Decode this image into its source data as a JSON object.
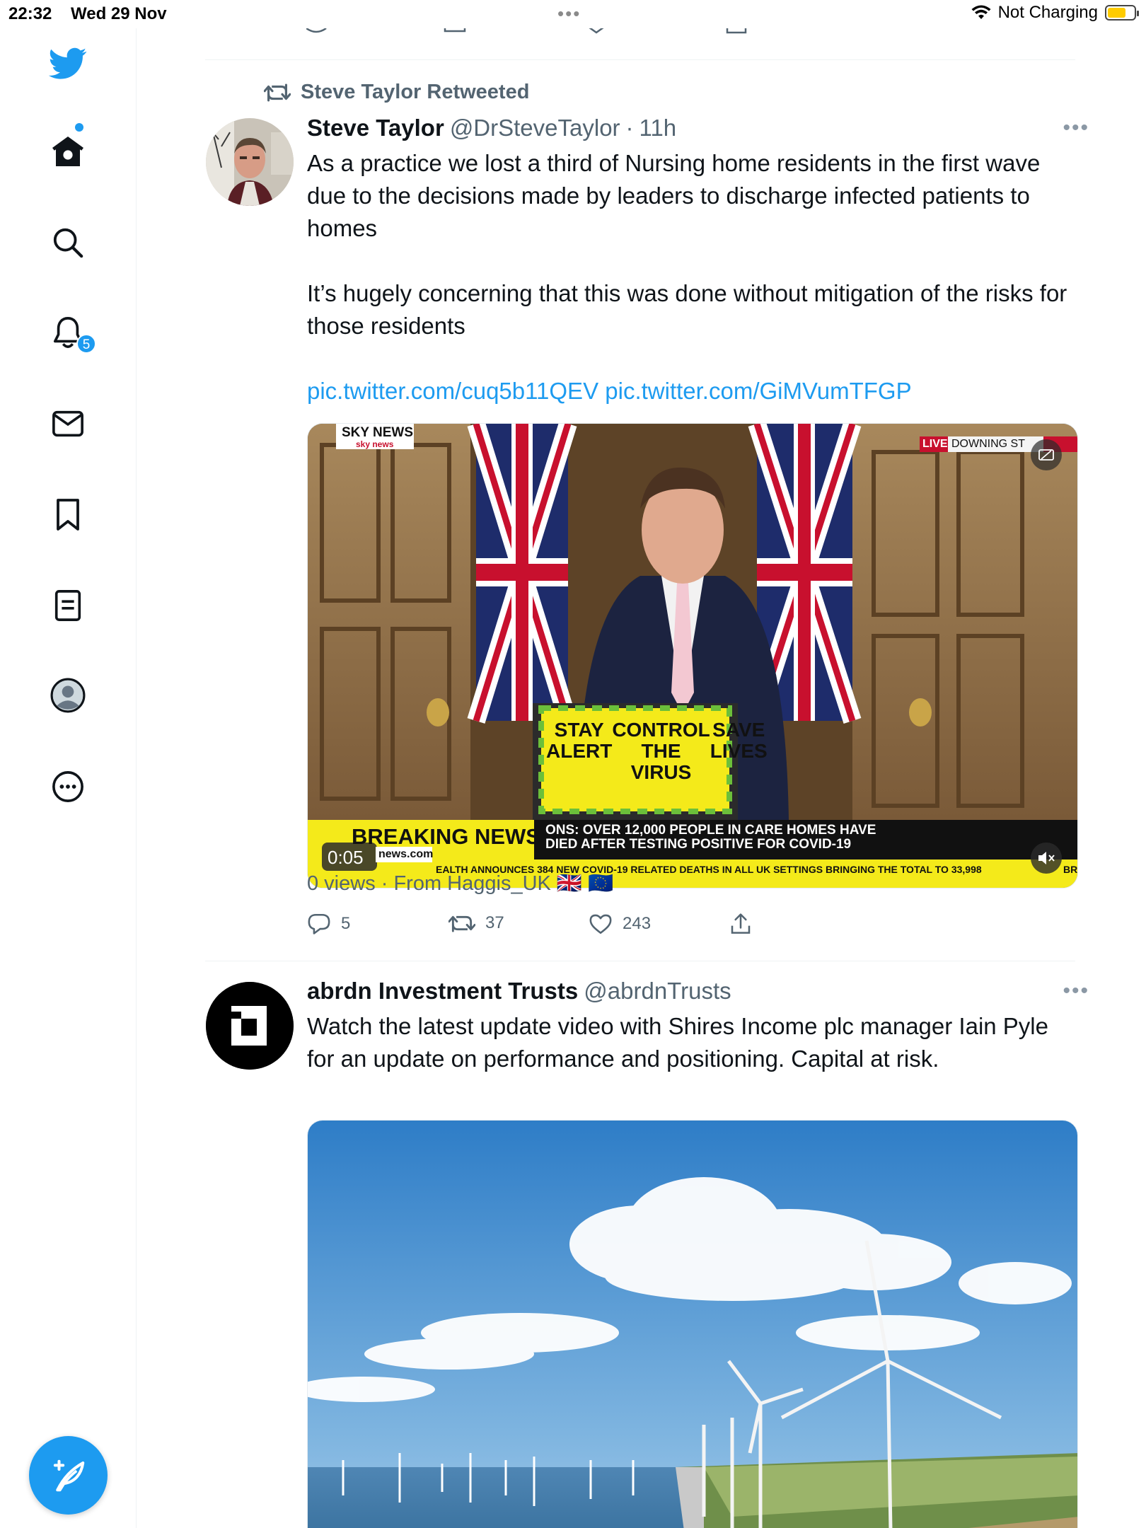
{
  "status_bar": {
    "time": "22:32",
    "date": "Wed 29 Nov",
    "charging": "Not Charging"
  },
  "sidebar": {
    "items": [
      {
        "icon": "twitter-bird-icon"
      },
      {
        "icon": "home-icon"
      },
      {
        "icon": "search-icon"
      },
      {
        "icon": "notifications-icon",
        "badge": "5"
      },
      {
        "icon": "messages-icon"
      },
      {
        "icon": "bookmarks-icon"
      },
      {
        "icon": "lists-icon"
      },
      {
        "icon": "profile-icon"
      },
      {
        "icon": "more-icon"
      }
    ],
    "compose_icon": "compose-tweet-icon"
  },
  "tweet1": {
    "retweeted_by": "Steve Taylor Retweeted",
    "name": "Steve Taylor",
    "handle": "@DrSteveTaylor",
    "time": "11h",
    "text_p1": "As a practice we lost a third of Nursing home residents in the first wave due to the decisions made by leaders to discharge infected patients to homes",
    "text_p2": "It’s hugely concerning that this was done without mitigation of the risks for those residents",
    "link1": "pic.twitter.com/cuq5b11QEV",
    "link2": "pic.twitter.com/GiMVumTFGP",
    "video": {
      "channel": "SKY NEWS",
      "channel_sub": "sky news",
      "live": "LIVE",
      "location": "DOWNING ST",
      "podium_1a": "STAY",
      "podium_1b": "ALERT",
      "podium_2a": "CONTROL",
      "podium_2b": "THE VIRUS",
      "podium_3a": "SAVE",
      "podium_3b": "LIVES",
      "breaking": "BREAKING NEWS",
      "headline_1": "ONS: OVER 12,000 PEOPLE IN CARE HOMES HAVE",
      "headline_2": "DIED AFTER TESTING POSITIVE FOR COVID-19",
      "site": "news.com",
      "ticker": "EALTH ANNOUNCES 384 NEW COVID-19 RELATED DEATHS IN ALL UK SETTINGS BRINGING THE TOTAL TO 33,998",
      "ticker_end": "BRE",
      "timestamp": "0:05"
    },
    "views": "0 views · From Haggis_UK 🇬🇧 🇪🇺",
    "replies": "5",
    "retweets": "37",
    "likes": "243"
  },
  "tweet2": {
    "name": "abrdn Investment Trusts",
    "handle": "@abrdnTrusts",
    "logo_letter": "a",
    "text": "Watch the latest update video with Shires Income plc manager Iain Pyle for an update on performance and positioning. Capital at risk."
  },
  "colors": {
    "accent": "#1d9bf0",
    "text_primary": "#0f1419",
    "text_secondary": "#536471"
  }
}
